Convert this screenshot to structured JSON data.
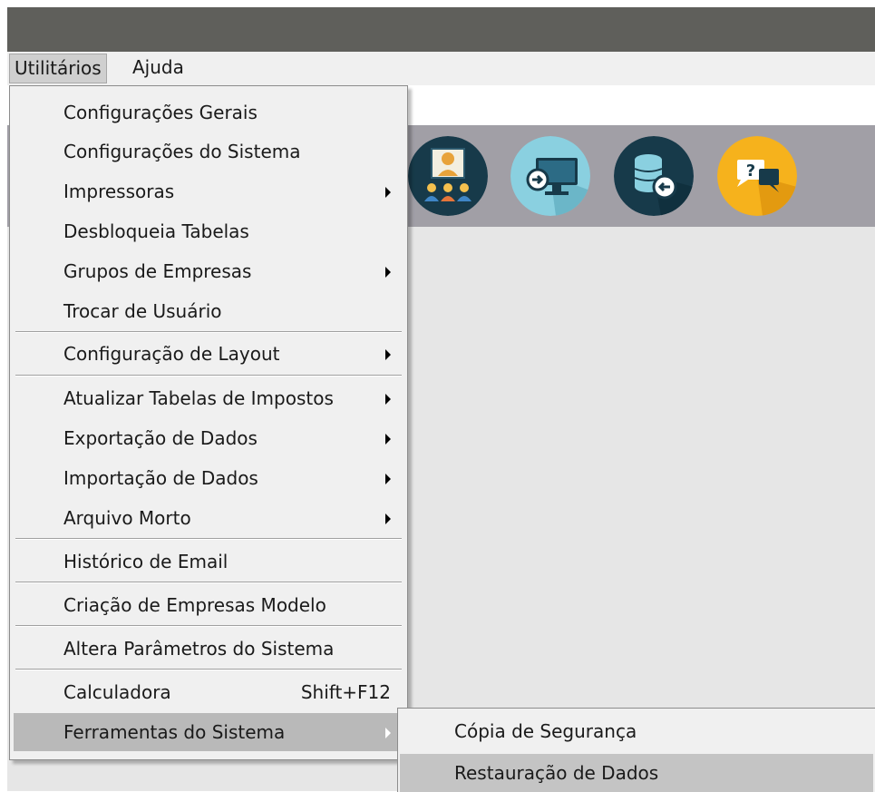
{
  "menubar": {
    "utilitarios": "Utilitários",
    "ajuda": "Ajuda"
  },
  "toolbar_icons": [
    "meeting-icon",
    "remote-access-icon",
    "database-restore-icon",
    "help-chat-icon"
  ],
  "utilitarios_menu": {
    "configuracoes_gerais": "Configurações Gerais",
    "configuracoes_sistema": "Configurações do Sistema",
    "impressoras": "Impressoras",
    "desbloqueia_tabelas": "Desbloqueia Tabelas",
    "grupos_empresas": "Grupos de Empresas",
    "trocar_usuario": "Trocar de Usuário",
    "configuracao_layout": "Configuração de Layout",
    "atualizar_tabelas_impostos": "Atualizar Tabelas de Impostos",
    "exportacao_dados": "Exportação de Dados",
    "importacao_dados": "Importação de Dados",
    "arquivo_morto": "Arquivo Morto",
    "historico_email": "Histórico de Email",
    "criacao_empresas_modelo": "Criação de Empresas Modelo",
    "altera_parametros": "Altera Parâmetros do Sistema",
    "calculadora": "Calculadora",
    "calculadora_shortcut": "Shift+F12",
    "ferramentas_sistema": "Ferramentas do Sistema"
  },
  "ferramentas_submenu": {
    "copia_seguranca": "Cópia de Segurança",
    "restauracao_dados": "Restauração de Dados"
  },
  "colors": {
    "titlebar": "#5f5f5b",
    "toolbar": "#a19fa6",
    "workspace": "#e6e6e6",
    "menu_bg": "#f0f0f0",
    "menu_highlight": "#b9b9b9"
  }
}
